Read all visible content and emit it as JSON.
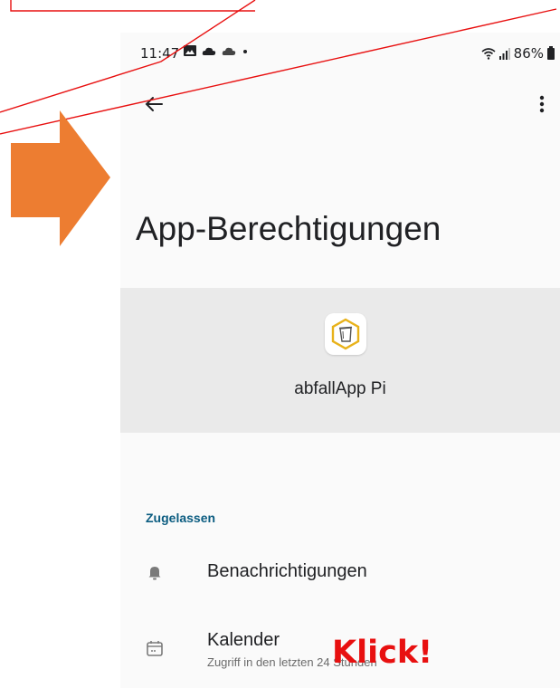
{
  "status_bar": {
    "time": "11:47",
    "left_icons": [
      "image-icon",
      "cloud-icon",
      "cloud-icon",
      "dot-icon"
    ],
    "battery_percent": "86%"
  },
  "toolbar": {
    "back_icon": "arrow-left-icon",
    "menu_icon": "more-vert-icon"
  },
  "page": {
    "title": "App-Berechtigungen"
  },
  "app": {
    "name": "abfallApp Pi",
    "icon": "trash-bin-icon"
  },
  "permissions": {
    "section_label": "Zugelassen",
    "items": [
      {
        "label": "Benachrichtigungen",
        "icon": "bell-icon"
      },
      {
        "label": "Kalender",
        "sublabel": "Zugriff in den letzten 24 Stunden",
        "icon": "calendar-icon"
      }
    ]
  },
  "annotation": {
    "text": "Klick!",
    "arrow_color": "#ed7d31",
    "callout_color": "#e81010"
  },
  "colors": {
    "section_accent": "#0b5c80",
    "header_bg": "#eaeaea",
    "app_icon_accent": "#e8b21a"
  }
}
